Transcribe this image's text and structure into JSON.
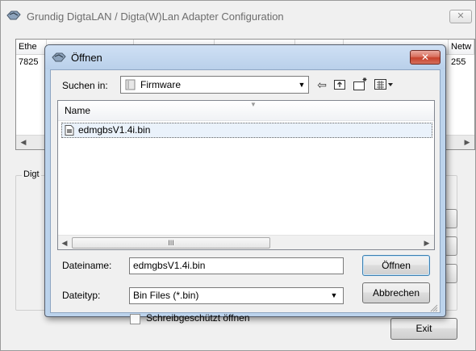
{
  "main_window": {
    "title": "Grundig DigtaLAN / Digta(W)Lan Adapter  Configuration",
    "close_glyph": "✕",
    "list": {
      "headers": [
        "Ethe",
        "",
        "",
        "",
        "",
        "",
        "Netw"
      ],
      "row": [
        "7825",
        "255"
      ]
    },
    "group_label": "Digt",
    "exit_label": "Exit"
  },
  "dialog": {
    "title": "Öffnen",
    "close_glyph": "✕",
    "lookin_label": "Suchen in:",
    "lookin_value": "Firmware",
    "column_name": "Name",
    "files": [
      "edmgbsV1.4i.bin"
    ],
    "filename_label": "Dateiname:",
    "filename_value": "edmgbsV1.4i.bin",
    "filetype_label": "Dateityp:",
    "filetype_value": "Bin Files (*.bin)",
    "open_label": "Öffnen",
    "cancel_label": "Abbrechen",
    "readonly_label": "Schreibgeschützt öffnen",
    "scroll_thumb_glyph": "III"
  },
  "icons": {
    "back": "back-arrow-icon",
    "up": "up-folder-icon",
    "new_folder": "new-folder-icon",
    "views": "views-menu-icon"
  }
}
